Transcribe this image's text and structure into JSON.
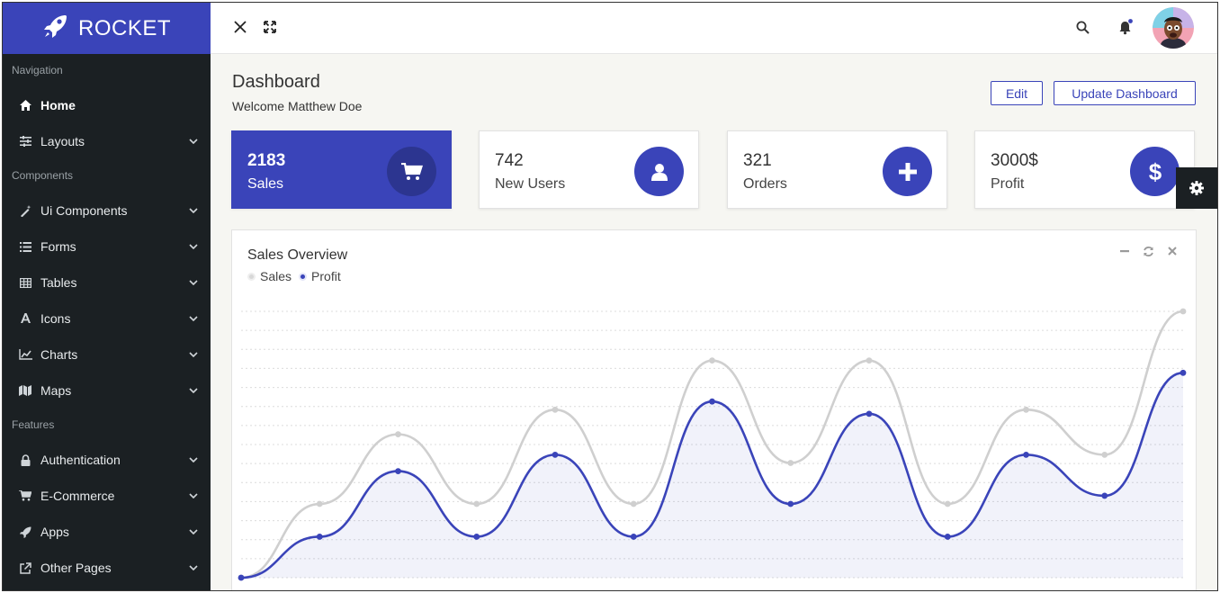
{
  "brand": {
    "name": "ROCKET"
  },
  "sidebar": {
    "sections": [
      {
        "title": "Navigation",
        "items": [
          {
            "label": "Home",
            "icon": "home-icon",
            "active": true,
            "chevron": false
          }
        ]
      },
      {
        "title": "Layouts",
        "items": []
      },
      {
        "title": "Components",
        "items": [
          {
            "label": "Ui Components",
            "icon": "magic-wand-icon",
            "chevron": true
          },
          {
            "label": "Forms",
            "icon": "list-icon",
            "chevron": true
          },
          {
            "label": "Tables",
            "icon": "table-icon",
            "chevron": true
          },
          {
            "label": "Icons",
            "icon": "font-icon",
            "chevron": true
          },
          {
            "label": "Charts",
            "icon": "line-chart-icon",
            "chevron": true
          },
          {
            "label": "Maps",
            "icon": "map-icon",
            "chevron": true
          }
        ]
      },
      {
        "title": "Features",
        "items": [
          {
            "label": "Authentication",
            "icon": "lock-icon",
            "chevron": true
          },
          {
            "label": "E-Commerce",
            "icon": "cart-icon",
            "chevron": true
          },
          {
            "label": "Apps",
            "icon": "rocket-icon",
            "chevron": true
          },
          {
            "label": "Other Pages",
            "icon": "external-link-icon",
            "chevron": true
          }
        ]
      }
    ],
    "layouts_label": "Layouts"
  },
  "header": {
    "title": "Dashboard",
    "subtitle": "Welcome Matthew Doe",
    "edit_label": "Edit",
    "update_label": "Update Dashboard"
  },
  "stats": [
    {
      "value": "2183",
      "label": "Sales",
      "icon": "cart-icon"
    },
    {
      "value": "742",
      "label": "New Users",
      "icon": "user-icon"
    },
    {
      "value": "321",
      "label": "Orders",
      "icon": "plus-icon"
    },
    {
      "value": "3000$",
      "label": "Profit",
      "icon": "dollar-icon"
    }
  ],
  "overview": {
    "title": "Sales Overview",
    "legend": [
      "Sales",
      "Profit"
    ]
  },
  "colors": {
    "accent": "#3a44b9",
    "sales_series": "#cfcfcf",
    "profit_series": "#3a44b9",
    "sidebar_bg": "#1b2023"
  },
  "chart_data": {
    "type": "line",
    "title": "Sales Overview",
    "x": [
      0,
      1,
      2,
      3,
      4,
      5,
      6,
      7,
      8,
      9,
      10,
      11,
      12
    ],
    "ylim": [
      0,
      130
    ],
    "grid": true,
    "legend_position": "top-left",
    "series": [
      {
        "name": "Sales",
        "values": [
          0,
          36,
          70,
          36,
          82,
          36,
          106,
          56,
          106,
          36,
          82,
          60,
          130
        ]
      },
      {
        "name": "Profit",
        "values": [
          0,
          20,
          52,
          20,
          60,
          20,
          86,
          36,
          80,
          20,
          60,
          40,
          100
        ],
        "fill": true
      }
    ]
  }
}
